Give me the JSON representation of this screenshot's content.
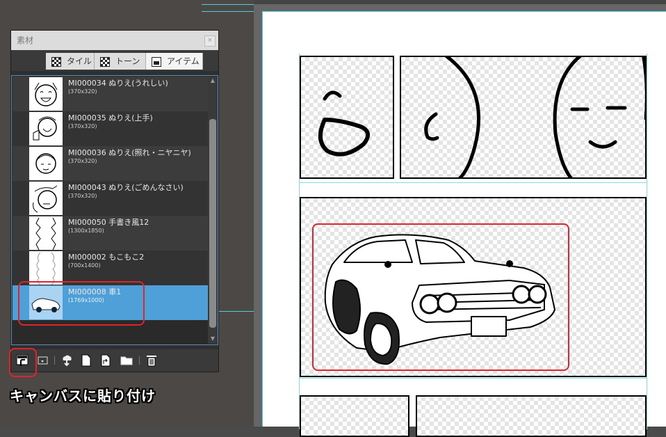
{
  "palette": {
    "title": "素材",
    "close_label": "×",
    "tabs": [
      {
        "label": "タイル",
        "icon": "tile-icon"
      },
      {
        "label": "トーン",
        "icon": "tone-icon"
      },
      {
        "label": "アイテム",
        "icon": "item-icon",
        "active": true
      }
    ],
    "items": [
      {
        "name": "MI000034 ぬりえ(うれしい)",
        "size": "(370x320)"
      },
      {
        "name": "MI000035 ぬりえ(上手)",
        "size": "(370x320)"
      },
      {
        "name": "MI000036 ぬりえ(照れ・ニヤニヤ)",
        "size": "(370x320)"
      },
      {
        "name": "MI000043 ぬりえ(ごめんなさい)",
        "size": "(370x320)"
      },
      {
        "name": "MI000050 手書き風12",
        "size": "(1300x1850)"
      },
      {
        "name": "MI000002 もこもこ2",
        "size": "(700x1400)"
      },
      {
        "name": "MI000008 車1",
        "size": "(1769x1000)",
        "selected": true
      }
    ],
    "toolbar_icons": [
      "paste-to-canvas-icon",
      "paste-icon",
      "download-icon",
      "new-file-icon",
      "import-icon",
      "folder-icon",
      "trash-icon"
    ]
  },
  "caption": "キャンバスに貼り付け",
  "colors": {
    "highlight": "#e0242c",
    "selection": "#4f9fd8",
    "guide": "#4fd0e0"
  }
}
